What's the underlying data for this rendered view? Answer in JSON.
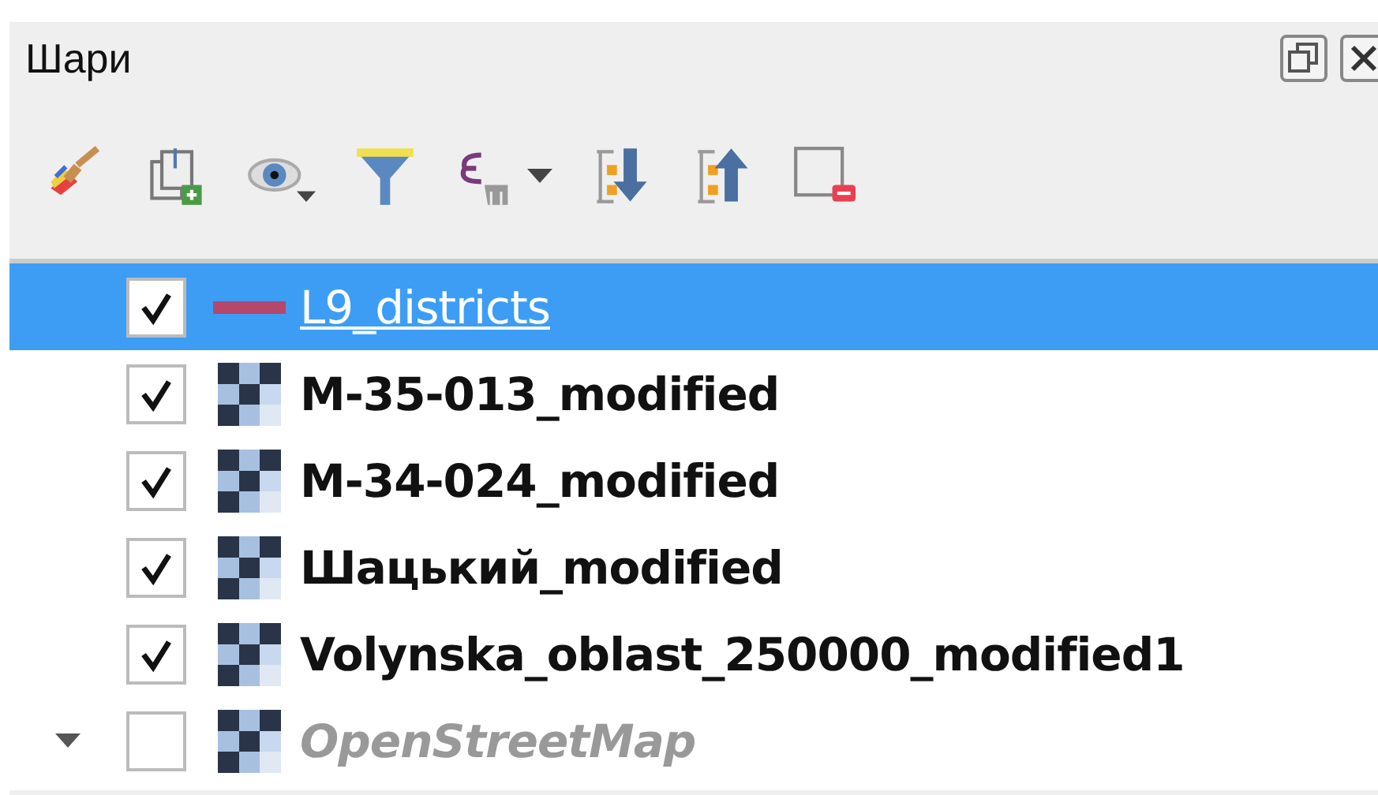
{
  "panel": {
    "title": "Шари"
  },
  "toolbar": [
    {
      "kind": "style"
    },
    {
      "kind": "add-group"
    },
    {
      "kind": "visibility",
      "dropdown": true
    },
    {
      "kind": "filter"
    },
    {
      "kind": "expression",
      "dropdown": true
    },
    {
      "kind": "expand"
    },
    {
      "kind": "collapse"
    },
    {
      "kind": "remove"
    }
  ],
  "layers": [
    {
      "name": "L9_districts",
      "kind": "line",
      "color": "#b5476c",
      "checked": true,
      "selected": true,
      "expandable": false
    },
    {
      "name": "M-35-013_modified",
      "kind": "raster",
      "checked": true,
      "selected": false,
      "expandable": false
    },
    {
      "name": "M-34-024_modified",
      "kind": "raster",
      "checked": true,
      "selected": false,
      "expandable": false
    },
    {
      "name": "Шацький_modified",
      "kind": "raster",
      "checked": true,
      "selected": false,
      "expandable": false
    },
    {
      "name": "Volynska_oblast_250000_modified1",
      "kind": "raster",
      "checked": true,
      "selected": false,
      "expandable": false
    },
    {
      "name": "OpenStreetMap",
      "kind": "raster",
      "checked": false,
      "selected": false,
      "expandable": true,
      "disabled": true
    }
  ]
}
